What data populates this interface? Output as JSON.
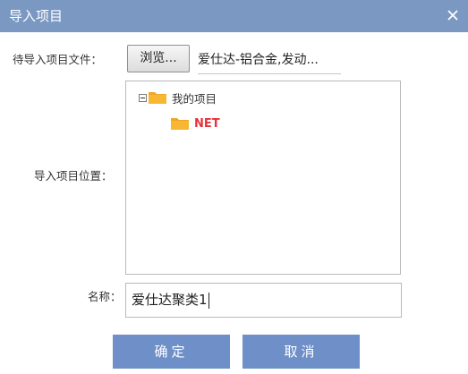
{
  "dialog": {
    "title": "导入项目",
    "close_icon": "close-icon"
  },
  "form": {
    "file_label": "待导入项目文件：",
    "browse_label": "浏览...",
    "file_value": "爱仕达-铝合金,发动...",
    "position_label": "导入项目位置：",
    "name_label": "名称：",
    "name_value": "爱仕达聚类1"
  },
  "tree": {
    "root": {
      "toggle_icon": "collapse-minus-icon",
      "icon": "folder-icon",
      "label": "我的项目"
    },
    "children": [
      {
        "icon": "folder-icon",
        "label": "NET",
        "color": "#e8313a"
      }
    ]
  },
  "buttons": {
    "ok_label": "确定",
    "cancel_label": "取消"
  },
  "colors": {
    "titlebar": "#7a98c2",
    "button": "#6f8fc9",
    "folder": "#f0a626"
  }
}
